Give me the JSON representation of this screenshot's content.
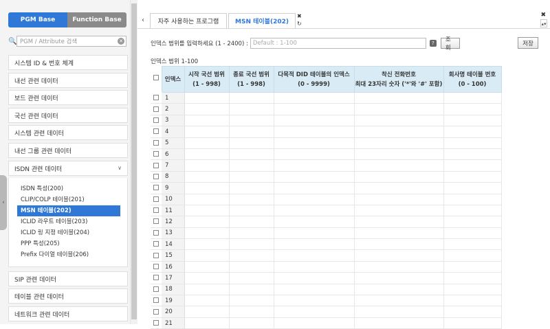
{
  "sidebar": {
    "mode_active": "PGM Base",
    "mode_inactive": "Function Base",
    "search_placeholder": "PGM / Attribute 검색",
    "menus": [
      "시스템 ID & 번호 체계",
      "내선 관련 데이터",
      "보드 관련 데이터",
      "국선 관련 데이터",
      "시스템 관련 데이터",
      "내선 그룹 관련 데이터",
      "ISDN 관련 데이터"
    ],
    "isdn_items": [
      "ISDN 특성(200)",
      "CLIP/COLP 테이블(201)",
      "MSN 테이블(202)",
      "ICLID 라우트 테이블(203)",
      "ICLID 링 지정 테이블(204)",
      "PPP 특성(205)",
      "Prefix 다이얼 테이블(206)"
    ],
    "menus_after": [
      "SIP 관련 데이터",
      "테이블 관련 데이터",
      "네트워크 관련 데이터"
    ]
  },
  "tabs": {
    "tab1": "자주 사용하는 프로그램",
    "tab2": "MSN 테이블(202)"
  },
  "form": {
    "label": "인덱스 범위를 입력하세요 (1 - 2400) :",
    "placeholder": "Default : 1-100",
    "search_button": "조회",
    "save_button": "저장",
    "range_text": "인덱스 범위 1-100"
  },
  "table": {
    "headers": [
      [
        "인덱스",
        ""
      ],
      [
        "시작 국선 범위",
        "(1 - 998)"
      ],
      [
        "종료 국선 범위",
        "(1 - 998)"
      ],
      [
        "다목적 DID 테이블의 인덱스",
        "(0 - 9999)"
      ],
      [
        "착신 전화번호",
        "최대 23자리 숫자 ('*'와 '#' 포함)"
      ],
      [
        "회사명 테이블 번호",
        "(0 - 100)"
      ]
    ],
    "rows": [
      "1",
      "2",
      "3",
      "4",
      "5",
      "6",
      "7",
      "8",
      "9",
      "10",
      "11",
      "12",
      "13",
      "14",
      "15",
      "16",
      "17",
      "18",
      "19",
      "20",
      "21"
    ]
  }
}
